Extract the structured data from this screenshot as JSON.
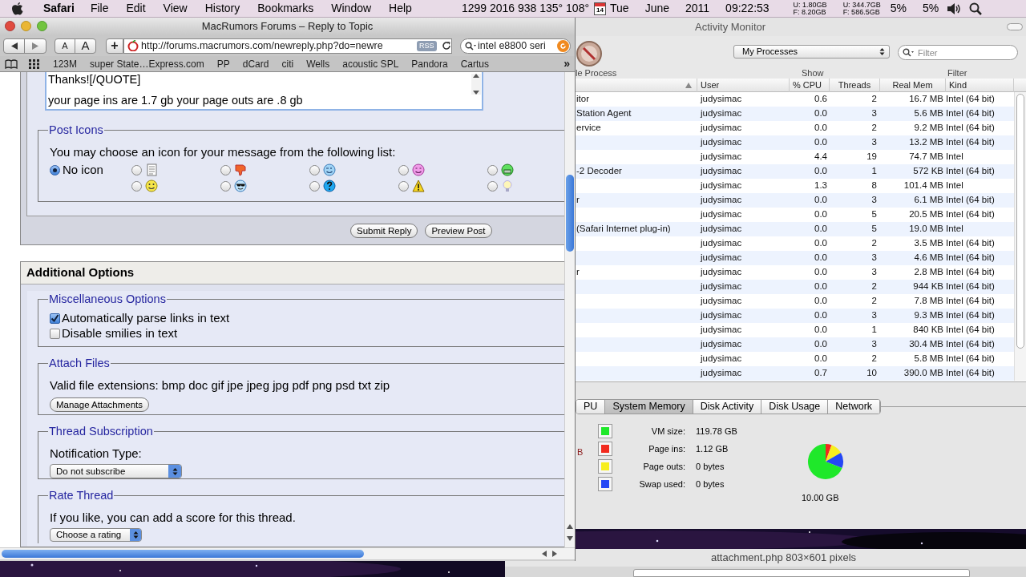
{
  "menubar": {
    "app": "Safari",
    "menus": [
      "File",
      "Edit",
      "View",
      "History",
      "Bookmarks",
      "Window",
      "Help"
    ],
    "temps": "1299 2016 938 135° 108°",
    "calendar_day": "14",
    "day": "Tue",
    "month": "June",
    "year": "2011",
    "time": "09:22:53",
    "memory": [
      "U: 1.80GB",
      "F: 8.20GB"
    ],
    "disk": [
      "U: 344.7GB",
      "F: 586.5GB"
    ],
    "cpu": [
      "5%",
      "5%"
    ]
  },
  "activity_monitor": {
    "title": "Activity Monitor",
    "toolbar_label": "le Process",
    "show": {
      "value": "My Processes",
      "label": "Show"
    },
    "filter": {
      "placeholder": "Filter",
      "label": "Filter"
    },
    "table": {
      "columns": [
        "User",
        "% CPU",
        "Threads",
        "Real Mem",
        "Kind"
      ],
      "rows": [
        {
          "name": "itor",
          "user": "judysimac",
          "cpu": "0.6",
          "threads": "2",
          "mem": "16.7 MB",
          "kind": "Intel (64 bit)"
        },
        {
          "name": "Station Agent",
          "user": "judysimac",
          "cpu": "0.0",
          "threads": "3",
          "mem": "5.6 MB",
          "kind": "Intel (64 bit)"
        },
        {
          "name": "ervice",
          "user": "judysimac",
          "cpu": "0.0",
          "threads": "2",
          "mem": "9.2 MB",
          "kind": "Intel (64 bit)"
        },
        {
          "user": "judysimac",
          "cpu": "0.0",
          "threads": "3",
          "mem": "13.2 MB",
          "kind": "Intel (64 bit)"
        },
        {
          "user": "judysimac",
          "cpu": "4.4",
          "threads": "19",
          "mem": "74.7 MB",
          "kind": "Intel"
        },
        {
          "name": "-2 Decoder",
          "user": "judysimac",
          "cpu": "0.0",
          "threads": "1",
          "mem": "572 KB",
          "kind": "Intel (64 bit)"
        },
        {
          "user": "judysimac",
          "cpu": "1.3",
          "threads": "8",
          "mem": "101.4 MB",
          "kind": "Intel"
        },
        {
          "name": "r",
          "user": "judysimac",
          "cpu": "0.0",
          "threads": "3",
          "mem": "6.1 MB",
          "kind": "Intel (64 bit)"
        },
        {
          "user": "judysimac",
          "cpu": "0.0",
          "threads": "5",
          "mem": "20.5 MB",
          "kind": "Intel (64 bit)"
        },
        {
          "name": "(Safari Internet plug-in)",
          "user": "judysimac",
          "cpu": "0.0",
          "threads": "5",
          "mem": "19.0 MB",
          "kind": "Intel"
        },
        {
          "user": "judysimac",
          "cpu": "0.0",
          "threads": "2",
          "mem": "3.5 MB",
          "kind": "Intel (64 bit)"
        },
        {
          "user": "judysimac",
          "cpu": "0.0",
          "threads": "3",
          "mem": "4.6 MB",
          "kind": "Intel (64 bit)"
        },
        {
          "name": "r",
          "user": "judysimac",
          "cpu": "0.0",
          "threads": "3",
          "mem": "2.8 MB",
          "kind": "Intel (64 bit)"
        },
        {
          "user": "judysimac",
          "cpu": "0.0",
          "threads": "2",
          "mem": "944 KB",
          "kind": "Intel (64 bit)"
        },
        {
          "user": "judysimac",
          "cpu": "0.0",
          "threads": "2",
          "mem": "7.8 MB",
          "kind": "Intel (64 bit)"
        },
        {
          "user": "judysimac",
          "cpu": "0.0",
          "threads": "3",
          "mem": "9.3 MB",
          "kind": "Intel (64 bit)"
        },
        {
          "user": "judysimac",
          "cpu": "0.0",
          "threads": "1",
          "mem": "840 KB",
          "kind": "Intel (64 bit)"
        },
        {
          "user": "judysimac",
          "cpu": "0.0",
          "threads": "3",
          "mem": "30.4 MB",
          "kind": "Intel (64 bit)"
        },
        {
          "user": "judysimac",
          "cpu": "0.0",
          "threads": "2",
          "mem": "5.8 MB",
          "kind": "Intel (64 bit)"
        },
        {
          "user": "judysimac",
          "cpu": "0.7",
          "threads": "10",
          "mem": "390.0 MB",
          "kind": "Intel (64 bit)"
        }
      ]
    },
    "tabs": [
      {
        "label": "PU",
        "selected": false
      },
      {
        "label": "System Memory",
        "selected": true
      },
      {
        "label": "Disk Activity",
        "selected": false
      },
      {
        "label": "Disk Usage",
        "selected": false
      },
      {
        "label": "Network",
        "selected": false
      }
    ],
    "cut_value": "B",
    "legend": [
      {
        "label": "VM size:",
        "value": "119.78 GB",
        "color": "#1fe82a"
      },
      {
        "label": "Page ins:",
        "value": "1.12 GB",
        "color": "#f22a1e"
      },
      {
        "label": "Page outs:",
        "value": "0 bytes",
        "color": "#f7ee1f"
      },
      {
        "label": "Swap used:",
        "value": "0 bytes",
        "color": "#2447f5"
      }
    ],
    "total": "10.00 GB"
  },
  "attachment_window": {
    "title": "attachment.php 803×601 pixels"
  },
  "safari": {
    "title": "MacRumors Forums – Reply to Topic",
    "text_size": [
      "A",
      "A"
    ],
    "add": "+",
    "url": "http://forums.macrumors.com/newreply.php?do=newre",
    "rss": "RSS",
    "search": "intel e8800 seri",
    "bookmarks": [
      "123M",
      "super State…Express.com",
      "PP",
      "dCard",
      "citi",
      "Wells",
      "acoustic SPL",
      "Pandora",
      "Cartus"
    ],
    "bookmarks_more": "»",
    "message_lines": [
      "Thanks![/QUOTE]",
      "your page ins are 1.7 gb  your page outs are .8 gb"
    ],
    "post_icons": {
      "legend": "Post Icons",
      "prompt": "You may choose an icon for your message from the following list:",
      "options": [
        {
          "kind": "none",
          "label": "No icon",
          "selected": true
        },
        {
          "kind": "note",
          "selected": false
        },
        {
          "kind": "thumbsdown",
          "selected": false
        },
        {
          "kind": "wink",
          "selected": false
        },
        {
          "kind": "blush",
          "selected": false
        },
        {
          "kind": "grin",
          "selected": false
        },
        {
          "kind": "smile",
          "selected": false
        },
        {
          "kind": "cool",
          "selected": false
        },
        {
          "kind": "question",
          "selected": false
        },
        {
          "kind": "warning",
          "selected": false
        },
        {
          "kind": "idea",
          "selected": false
        }
      ]
    },
    "buttons": [
      "Submit Reply",
      "Preview Post"
    ],
    "additional": {
      "title": "Additional Options",
      "misc": {
        "legend": "Miscellaneous Options",
        "options": [
          {
            "label": "Automatically parse links in text",
            "checked": true
          },
          {
            "label": "Disable smilies in text",
            "checked": false
          }
        ]
      },
      "attach": {
        "legend": "Attach Files",
        "extensions": "Valid file extensions: bmp doc gif jpe jpeg jpg pdf png psd txt zip",
        "button": "Manage Attachments"
      },
      "subscription": {
        "legend": "Thread Subscription",
        "label": "Notification Type:",
        "value": "Do not subscribe"
      },
      "rate": {
        "legend": "Rate Thread",
        "text": "If you like, you can add a score for this thread.",
        "value": "Choose a rating"
      }
    }
  }
}
